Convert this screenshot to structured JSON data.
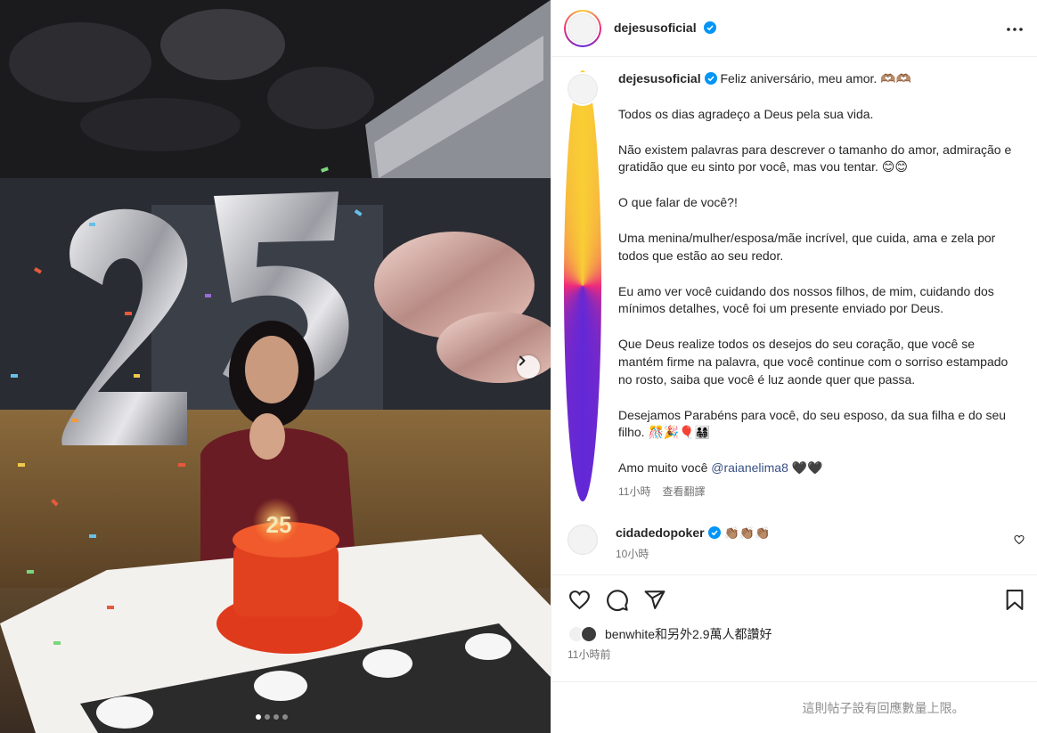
{
  "photo": {
    "alt_icon": "photo-carousel",
    "cake_number": "25",
    "balloon_number": "25",
    "carousel_dots": 4,
    "active_dot": 0
  },
  "header": {
    "username": "dejesusoficial",
    "more_icon": "more-horizontal-icon"
  },
  "caption": {
    "username": "dejesusoficial",
    "first_line": "Feliz aniversário, meu amor. 🫶🏽🫶🏽",
    "paragraphs": [
      "Todos os dias agradeço a Deus pela sua vida.",
      "Não existem palavras para descrever o tamanho do amor, admiração e gratidão que eu sinto por você, mas vou tentar. 😊😊",
      "O que falar de você?!",
      "Uma menina/mulher/esposa/mãe incrível, que cuida, ama e zela por todos que estão ao seu redor.",
      "Eu amo ver você cuidando dos nossos filhos, de mim, cuidando dos mínimos detalhes, você foi um presente enviado por Deus.",
      "Que Deus realize todos os desejos do seu coração, que você se mantém firme na palavra, que você continue com o sorriso estampado no rosto, saiba que você é luz aonde quer que passa.",
      "Desejamos Parabéns para você, do seu esposo, da sua filha e do seu filho. 🎊🎉🎈👨‍👩‍👧‍👦"
    ],
    "last_line_prefix": "Amo muito você ",
    "mention": "@raianelima8",
    "last_line_suffix": " 🖤🖤",
    "time": "11小時",
    "translate": "查看翻譯"
  },
  "comment": {
    "username": "cidadedopoker",
    "text": "👏🏽👏🏽👏🏽",
    "time": "10小時"
  },
  "likes": {
    "text": "benwhite和另外2.9萬人都讚好"
  },
  "post_time": "11小時前",
  "comments_limited": "這則帖子設有回應數量上限。",
  "colors": {
    "verified": "#0095f6",
    "mention": "#385185",
    "secondary": "#737373"
  }
}
